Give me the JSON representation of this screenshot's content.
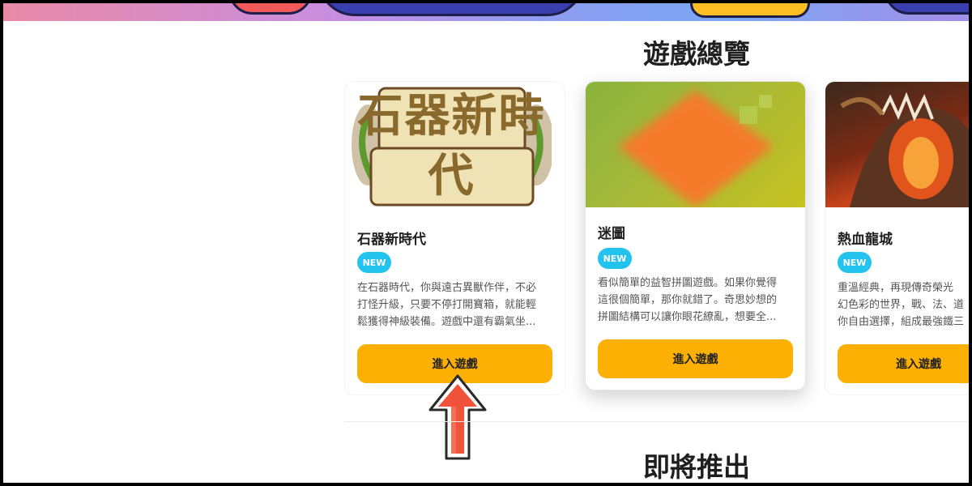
{
  "sections": {
    "overview_title": "遊戲總覽",
    "coming_soon_title": "即將推出"
  },
  "cards": [
    {
      "name": "石器新時代",
      "badge": "NEW",
      "image_text": "石器新時代",
      "description_lines": [
        "在石器時代，你與遠古異獸作伴，不必",
        "打怪升級，只要不停打開寶箱，就能輕",
        "鬆獲得神級裝備。遊戲中還有霸氣坐..."
      ],
      "button_label": "進入遊戲"
    },
    {
      "name": "迷圖",
      "badge": "NEW",
      "description_lines": [
        "看似簡單的益智拼圖遊戲。如果你覺得",
        "這很個簡單，那你就錯了。奇思妙想的",
        "拼圖結構可以讓你眼花繚亂，想要全..."
      ],
      "button_label": "進入遊戲"
    },
    {
      "name": "熱血龍城",
      "badge": "NEW",
      "description_lines": [
        "重溫經典，再現傳奇榮光",
        "幻色彩的世界，戰、法、道",
        "你自由選擇，組成最強鐵三"
      ],
      "button_label": "進入遊戲"
    }
  ],
  "colors": {
    "accent_button": "#fbb003",
    "badge": "#22c3ef",
    "arrow": "#f0533a"
  },
  "icons": {
    "pointer": "up-arrow-icon"
  }
}
